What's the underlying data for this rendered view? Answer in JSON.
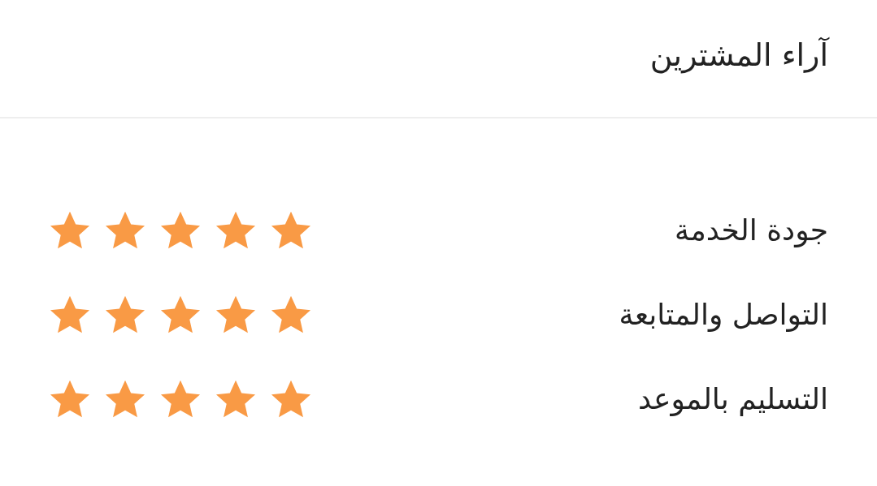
{
  "title": "آراء المشترين",
  "ratings": [
    {
      "label": "جودة الخدمة",
      "stars": 5
    },
    {
      "label": "التواصل والمتابعة",
      "stars": 5
    },
    {
      "label": "التسليم بالموعد",
      "stars": 5
    }
  ]
}
